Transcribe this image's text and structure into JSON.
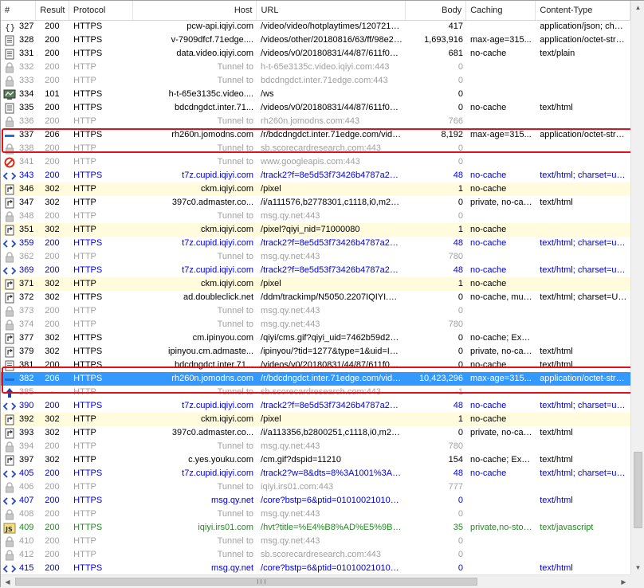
{
  "columns": {
    "num": "#",
    "result": "Result",
    "protocol": "Protocol",
    "host": "Host",
    "url": "URL",
    "body": "Body",
    "caching": "Caching",
    "ctype": "Content-Type"
  },
  "rows": [
    {
      "num": "327",
      "result": "200",
      "protocol": "HTTPS",
      "host": "pcw-api.iqiyi.com",
      "url": "/video/video/hotplaytimes/1207215800,...",
      "body": "417",
      "caching": "",
      "ctype": "application/json; chars...",
      "style": "normal",
      "icon": "json-icon"
    },
    {
      "num": "328",
      "result": "200",
      "protocol": "HTTPS",
      "host": "v-7909dfcf.71edge....",
      "url": "/videos/other/20180816/63/ff/98e2034...",
      "body": "1,693,916",
      "caching": "max-age=315...",
      "ctype": "application/octet-stream",
      "style": "normal",
      "icon": "document-icon"
    },
    {
      "num": "331",
      "result": "200",
      "protocol": "HTTPS",
      "host": "data.video.iqiyi.com",
      "url": "/videos/v0/20180831/44/87/611f0244cf...",
      "body": "681",
      "caching": "no-cache",
      "ctype": "text/plain",
      "style": "normal",
      "icon": "document-icon"
    },
    {
      "num": "332",
      "result": "200",
      "protocol": "HTTP",
      "host": "Tunnel to",
      "url": "h-t-65e3135c.video.iqiyi.com:443",
      "body": "0",
      "caching": "",
      "ctype": "",
      "style": "tunnel",
      "icon": "lock-icon"
    },
    {
      "num": "333",
      "result": "200",
      "protocol": "HTTP",
      "host": "Tunnel to",
      "url": "bdcdngdct.inter.71edge.com:443",
      "body": "0",
      "caching": "",
      "ctype": "",
      "style": "tunnel",
      "icon": "lock-icon"
    },
    {
      "num": "334",
      "result": "101",
      "protocol": "HTTPS",
      "host": "h-t-65e3135c.video....",
      "url": "/ws",
      "body": "0",
      "caching": "",
      "ctype": "",
      "style": "normal",
      "icon": "websocket-icon"
    },
    {
      "num": "335",
      "result": "200",
      "protocol": "HTTPS",
      "host": "bdcdngdct.inter.71...",
      "url": "/videos/v0/20180831/44/87/611f0244cf...",
      "body": "0",
      "caching": "no-cache",
      "ctype": "text/html",
      "style": "normal",
      "icon": "document-icon"
    },
    {
      "num": "336",
      "result": "200",
      "protocol": "HTTP",
      "host": "Tunnel to",
      "url": "rh260n.jomodns.com:443",
      "body": "766",
      "caching": "",
      "ctype": "",
      "style": "tunnel",
      "icon": "lock-icon"
    },
    {
      "num": "337",
      "result": "206",
      "protocol": "HTTPS",
      "host": "rh260n.jomodns.com",
      "url": "/r/bdcdngdct.inter.71edge.com/videos/...",
      "body": "8,192",
      "caching": "max-age=315...",
      "ctype": "application/octet-stream",
      "style": "normal",
      "icon": "partial-icon"
    },
    {
      "num": "338",
      "result": "200",
      "protocol": "HTTP",
      "host": "Tunnel to",
      "url": "sb.scorecardresearch.com:443",
      "body": "0",
      "caching": "",
      "ctype": "",
      "style": "tunnel",
      "icon": "lock-icon"
    },
    {
      "num": "341",
      "result": "200",
      "protocol": "HTTP",
      "host": "Tunnel to",
      "url": "www.googleapis.com:443",
      "body": "0",
      "caching": "",
      "ctype": "",
      "style": "tunnel",
      "icon": "blocked-icon"
    },
    {
      "num": "343",
      "result": "200",
      "protocol": "HTTPS",
      "host": "t7z.cupid.iqiyi.com",
      "url": "/track2?f=8e5d53f73426b4787a20f0b3...",
      "body": "48",
      "caching": "no-cache",
      "ctype": "text/html; charset=utf-8",
      "style": "blue",
      "icon": "code-icon"
    },
    {
      "num": "346",
      "result": "302",
      "protocol": "HTTP",
      "host": "ckm.iqiyi.com",
      "url": "/pixel",
      "body": "1",
      "caching": "no-cache",
      "ctype": "",
      "style": "yellow",
      "icon": "redirect-icon"
    },
    {
      "num": "347",
      "result": "302",
      "protocol": "HTTP",
      "host": "397c0.admaster.co...",
      "url": "/i/a111576,b2778301,c1118,i0,m202,8a...",
      "body": "0",
      "caching": "private, no-cac...",
      "ctype": "text/html",
      "style": "normal",
      "icon": "redirect-icon"
    },
    {
      "num": "348",
      "result": "200",
      "protocol": "HTTP",
      "host": "Tunnel to",
      "url": "msg.qy.net:443",
      "body": "0",
      "caching": "",
      "ctype": "",
      "style": "tunnel",
      "icon": "lock-icon"
    },
    {
      "num": "351",
      "result": "302",
      "protocol": "HTTP",
      "host": "ckm.iqiyi.com",
      "url": "/pixel?qiyi_nid=71000080",
      "body": "1",
      "caching": "no-cache",
      "ctype": "",
      "style": "yellow",
      "icon": "redirect-icon"
    },
    {
      "num": "359",
      "result": "200",
      "protocol": "HTTPS",
      "host": "t7z.cupid.iqiyi.com",
      "url": "/track2?f=8e5d53f73426b4787a20f0b3...",
      "body": "48",
      "caching": "no-cache",
      "ctype": "text/html; charset=utf-8",
      "style": "blue",
      "icon": "code-icon"
    },
    {
      "num": "362",
      "result": "200",
      "protocol": "HTTP",
      "host": "Tunnel to",
      "url": "msg.qy.net:443",
      "body": "780",
      "caching": "",
      "ctype": "",
      "style": "tunnel",
      "icon": "lock-icon"
    },
    {
      "num": "369",
      "result": "200",
      "protocol": "HTTPS",
      "host": "t7z.cupid.iqiyi.com",
      "url": "/track2?f=8e5d53f73426b4787a20f0b3...",
      "body": "48",
      "caching": "no-cache",
      "ctype": "text/html; charset=utf-8",
      "style": "blue",
      "icon": "code-icon"
    },
    {
      "num": "371",
      "result": "302",
      "protocol": "HTTP",
      "host": "ckm.iqiyi.com",
      "url": "/pixel",
      "body": "1",
      "caching": "no-cache",
      "ctype": "",
      "style": "yellow",
      "icon": "redirect-icon"
    },
    {
      "num": "372",
      "result": "302",
      "protocol": "HTTPS",
      "host": "ad.doubleclick.net",
      "url": "/ddm/trackimp/N5050.2207IQIYI.COM/B...",
      "body": "0",
      "caching": "no-cache, mus...",
      "ctype": "text/html; charset=UT...",
      "style": "normal",
      "icon": "redirect-icon"
    },
    {
      "num": "373",
      "result": "200",
      "protocol": "HTTP",
      "host": "Tunnel to",
      "url": "msg.qy.net:443",
      "body": "0",
      "caching": "",
      "ctype": "",
      "style": "tunnel",
      "icon": "lock-icon"
    },
    {
      "num": "374",
      "result": "200",
      "protocol": "HTTP",
      "host": "Tunnel to",
      "url": "msg.qy.net:443",
      "body": "780",
      "caching": "",
      "ctype": "",
      "style": "tunnel",
      "icon": "lock-icon"
    },
    {
      "num": "377",
      "result": "302",
      "protocol": "HTTPS",
      "host": "cm.ipinyou.com",
      "url": "/qiyi/cms.gif?qiyi_uid=7462b59d2be0c5...",
      "body": "0",
      "caching": "no-cache; Expi...",
      "ctype": "",
      "style": "normal",
      "icon": "redirect-icon"
    },
    {
      "num": "379",
      "result": "302",
      "protocol": "HTTPS",
      "host": "ipinyou.cm.admaste...",
      "url": "/ipinyou/?tid=1277&type=1&uid=I92HL...",
      "body": "0",
      "caching": "private, no-cac...",
      "ctype": "text/html",
      "style": "normal",
      "icon": "redirect-icon"
    },
    {
      "num": "381",
      "result": "200",
      "protocol": "HTTPS",
      "host": "bdcdngdct.inter.71...",
      "url": "/videos/v0/20180831/44/87/611f0244cf...",
      "body": "0",
      "caching": "no-cache",
      "ctype": "text/html",
      "style": "normal",
      "icon": "document-icon"
    },
    {
      "num": "382",
      "result": "206",
      "protocol": "HTTPS",
      "host": "rh260n.jomodns.com",
      "url": "/r/bdcdngdct.inter.71edge.com/videos/...",
      "body": "10,423,296",
      "caching": "max-age=315...",
      "ctype": "application/octet-stream",
      "style": "selected",
      "icon": "partial-icon"
    },
    {
      "num": "385",
      "result": "-",
      "protocol": "HTTP",
      "host": "Tunnel to",
      "url": "sb.scorecardresearch.com:443",
      "body": "-1",
      "caching": "",
      "ctype": "",
      "style": "tunnel",
      "icon": "upload-icon"
    },
    {
      "num": "390",
      "result": "200",
      "protocol": "HTTPS",
      "host": "t7z.cupid.iqiyi.com",
      "url": "/track2?f=8e5d53f73426b4787a20f0b3...",
      "body": "48",
      "caching": "no-cache",
      "ctype": "text/html; charset=utf-8",
      "style": "blue",
      "icon": "code-icon"
    },
    {
      "num": "392",
      "result": "302",
      "protocol": "HTTP",
      "host": "ckm.iqiyi.com",
      "url": "/pixel",
      "body": "1",
      "caching": "no-cache",
      "ctype": "",
      "style": "yellow",
      "icon": "redirect-icon"
    },
    {
      "num": "393",
      "result": "302",
      "protocol": "HTTP",
      "host": "397c0.admaster.co...",
      "url": "/i/a113356,b2800251,c1118,i0,m202,8a...",
      "body": "0",
      "caching": "private, no-cac...",
      "ctype": "text/html",
      "style": "normal",
      "icon": "redirect-icon"
    },
    {
      "num": "394",
      "result": "200",
      "protocol": "HTTP",
      "host": "Tunnel to",
      "url": "msg.qy.net:443",
      "body": "780",
      "caching": "",
      "ctype": "",
      "style": "tunnel",
      "icon": "lock-icon"
    },
    {
      "num": "397",
      "result": "302",
      "protocol": "HTTP",
      "host": "c.yes.youku.com",
      "url": "/cm.gif?dspid=11210",
      "body": "154",
      "caching": "no-cache; Expi...",
      "ctype": "text/html",
      "style": "normal",
      "icon": "redirect-icon"
    },
    {
      "num": "405",
      "result": "200",
      "protocol": "HTTPS",
      "host": "t7z.cupid.iqiyi.com",
      "url": "/track2?w=8&dts=8%3A1001%3A&nr=...",
      "body": "48",
      "caching": "no-cache",
      "ctype": "text/html; charset=utf-8",
      "style": "blue",
      "icon": "code-icon"
    },
    {
      "num": "406",
      "result": "200",
      "protocol": "HTTP",
      "host": "Tunnel to",
      "url": "iqiyi.irs01.com:443",
      "body": "777",
      "caching": "",
      "ctype": "",
      "style": "tunnel",
      "icon": "lock-icon"
    },
    {
      "num": "407",
      "result": "200",
      "protocol": "HTTPS",
      "host": "msg.qy.net",
      "url": "/core?bstp=6&ptid=0101002101000000...",
      "body": "0",
      "caching": "",
      "ctype": "text/html",
      "style": "blue",
      "icon": "code-icon"
    },
    {
      "num": "408",
      "result": "200",
      "protocol": "HTTP",
      "host": "Tunnel to",
      "url": "msg.qy.net:443",
      "body": "0",
      "caching": "",
      "ctype": "",
      "style": "tunnel",
      "icon": "lock-icon"
    },
    {
      "num": "409",
      "result": "200",
      "protocol": "HTTPS",
      "host": "iqiyi.irs01.com",
      "url": "/hvt?title=%E4%B8%AD%E5%9B%BD...",
      "body": "35",
      "caching": "private,no-stor...",
      "ctype": "text/javascript",
      "style": "green",
      "icon": "js-icon"
    },
    {
      "num": "410",
      "result": "200",
      "protocol": "HTTP",
      "host": "Tunnel to",
      "url": "msg.qy.net:443",
      "body": "0",
      "caching": "",
      "ctype": "",
      "style": "tunnel",
      "icon": "lock-icon"
    },
    {
      "num": "412",
      "result": "200",
      "protocol": "HTTP",
      "host": "Tunnel to",
      "url": "sb.scorecardresearch.com:443",
      "body": "0",
      "caching": "",
      "ctype": "",
      "style": "tunnel",
      "icon": "lock-icon"
    },
    {
      "num": "415",
      "result": "200",
      "protocol": "HTTPS",
      "host": "msg.qy.net",
      "url": "/core?bstp=6&ptid=0101002101000000...",
      "body": "0",
      "caching": "",
      "ctype": "text/html",
      "style": "blue",
      "icon": "code-icon"
    }
  ],
  "colors": {
    "highlight_outline": "#e0101c",
    "selected_row": "#3399ff",
    "tunnel_text": "#a0a0a0",
    "blue_text": "#0000e0",
    "green_text": "#228b22",
    "yellow_row": "#fffbdc"
  }
}
